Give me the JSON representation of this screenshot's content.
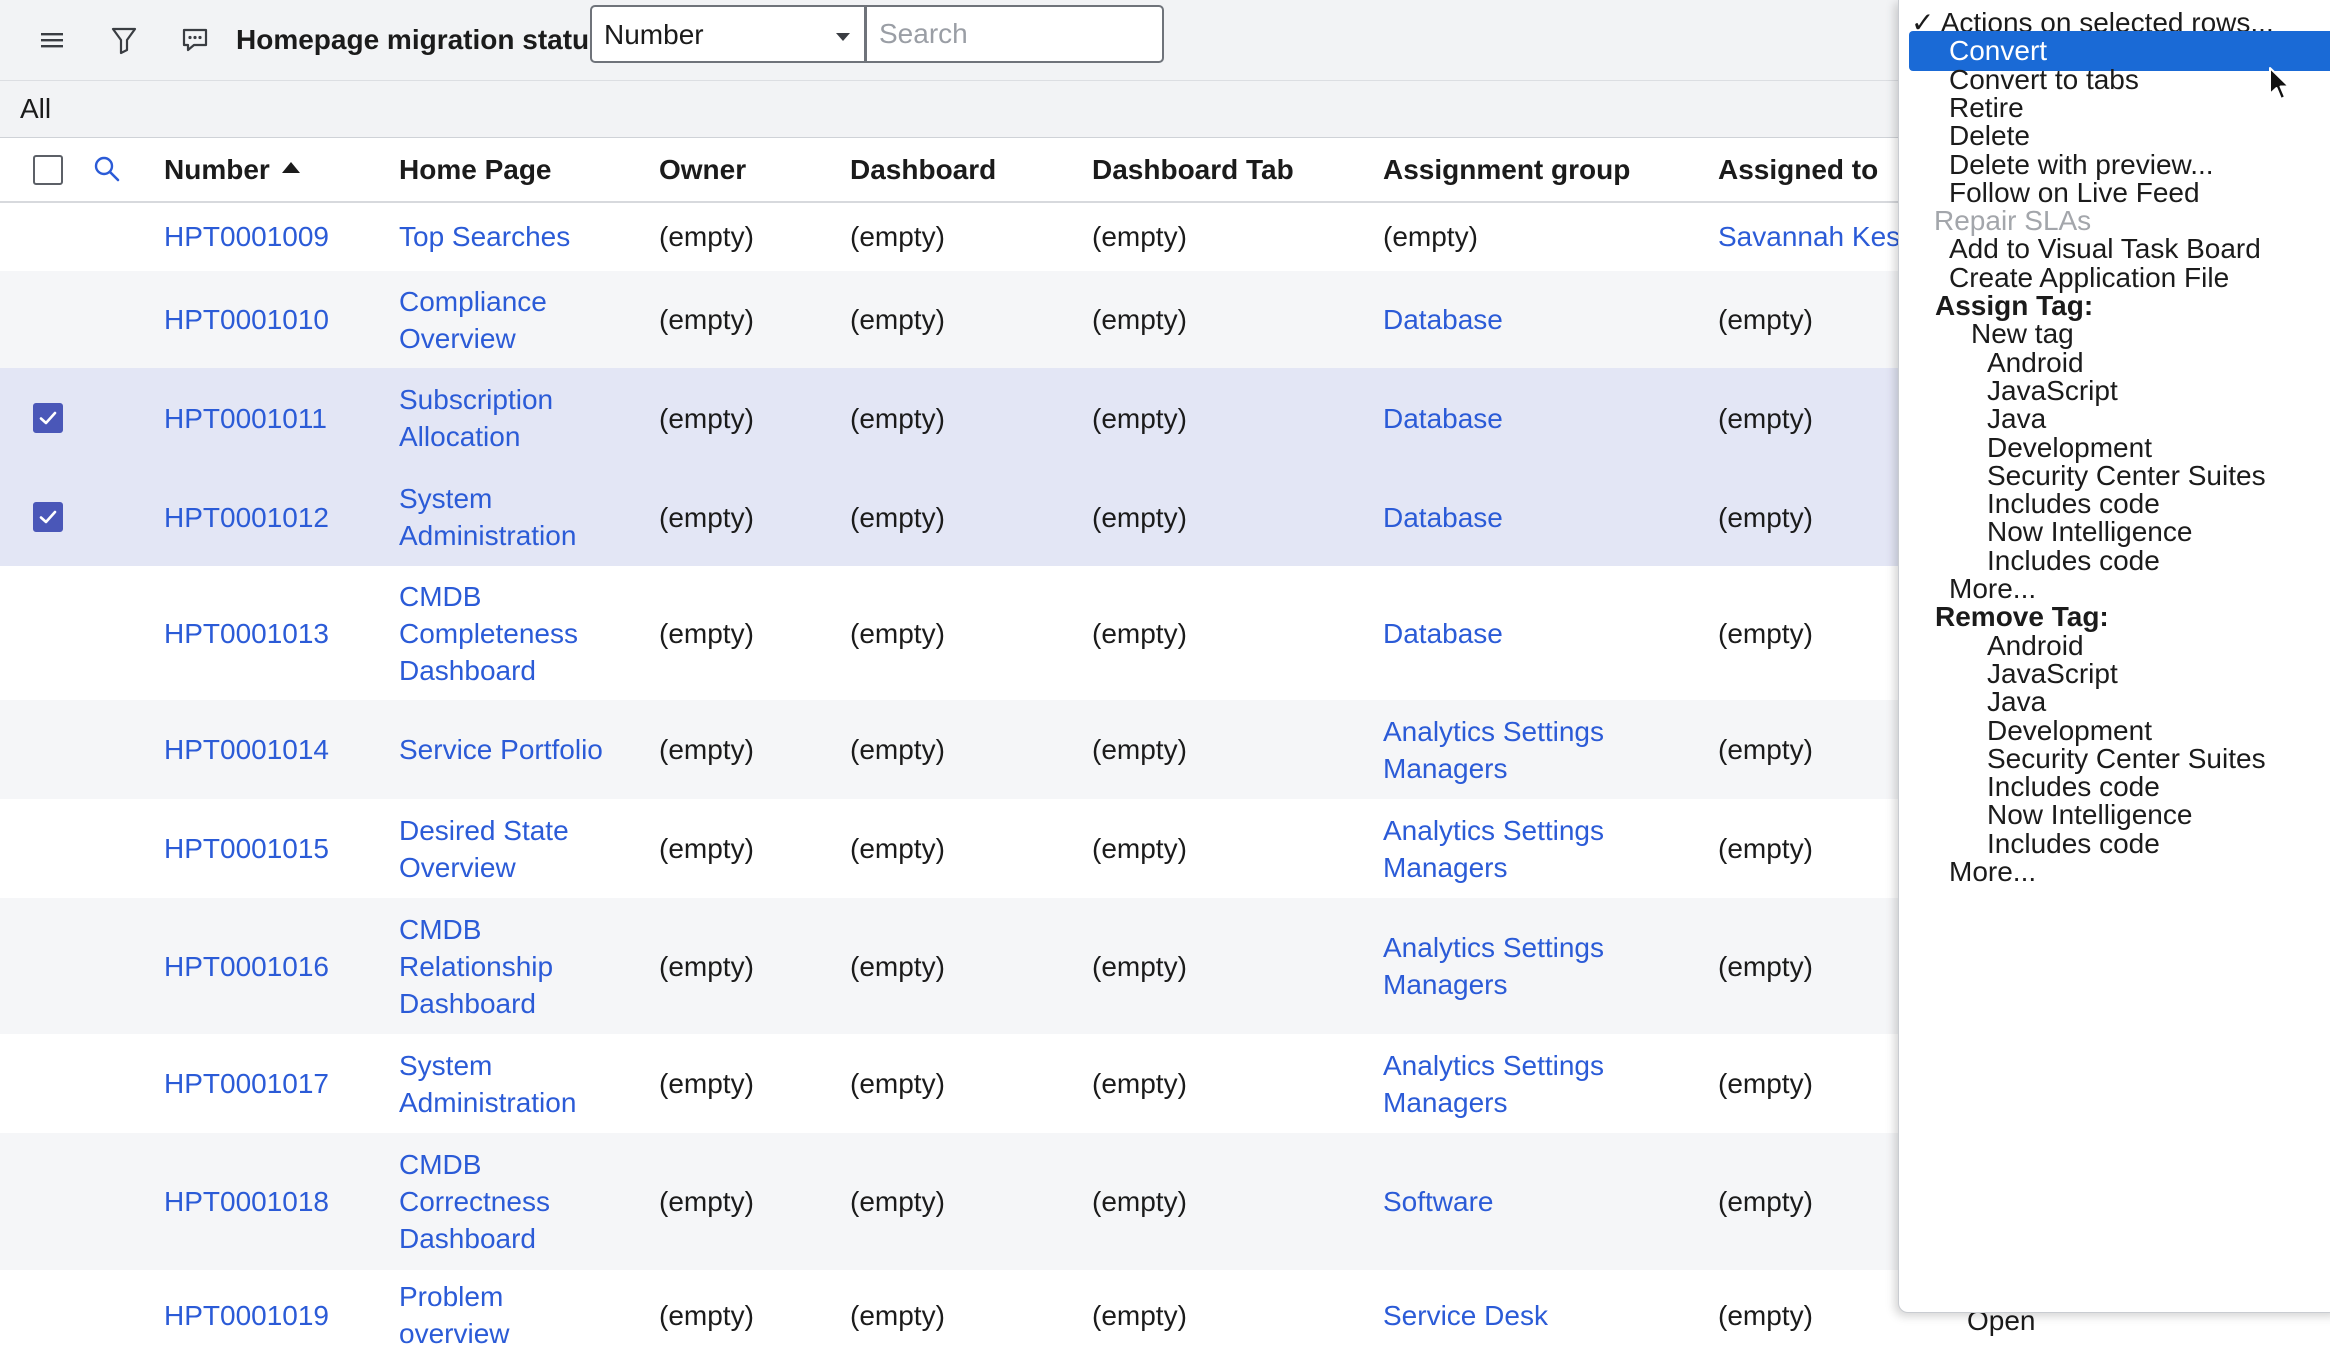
{
  "header": {
    "title": "Homepage migration status",
    "field_select": "Number",
    "search_placeholder": "Search",
    "icons": [
      "hamburger-menu-icon",
      "filter-icon",
      "comment-icon"
    ]
  },
  "breadcrumb": "All",
  "columns": {
    "number": "Number",
    "home_page": "Home Page",
    "owner": "Owner",
    "dashboard": "Dashboard",
    "dashboard_tab": "Dashboard Tab",
    "assignment_group": "Assignment group",
    "assigned_to": "Assigned to"
  },
  "rows": [
    {
      "number": "HPT0001009",
      "home": [
        "Top Searches"
      ],
      "owner": "(empty)",
      "dashboard": "(empty)",
      "tab": "(empty)",
      "group": [
        "(empty)"
      ],
      "assigned": "Savannah Kesi"
    },
    {
      "number": "HPT0001010",
      "home": [
        "Compliance",
        "Overview"
      ],
      "owner": "(empty)",
      "dashboard": "(empty)",
      "tab": "(empty)",
      "group": [
        "Database"
      ],
      "assigned": "(empty)"
    },
    {
      "number": "HPT0001011",
      "home": [
        "Subscription",
        "Allocation"
      ],
      "owner": "(empty)",
      "dashboard": "(empty)",
      "tab": "(empty)",
      "group": [
        "Database"
      ],
      "assigned": "(empty)"
    },
    {
      "number": "HPT0001012",
      "home": [
        "System",
        "Administration"
      ],
      "owner": "(empty)",
      "dashboard": "(empty)",
      "tab": "(empty)",
      "group": [
        "Database"
      ],
      "assigned": "(empty)"
    },
    {
      "number": "HPT0001013",
      "home": [
        "CMDB",
        "Completeness",
        "Dashboard"
      ],
      "owner": "(empty)",
      "dashboard": "(empty)",
      "tab": "(empty)",
      "group": [
        "Database"
      ],
      "assigned": "(empty)"
    },
    {
      "number": "HPT0001014",
      "home": [
        "Service Portfolio"
      ],
      "owner": "(empty)",
      "dashboard": "(empty)",
      "tab": "(empty)",
      "group": [
        "Analytics Settings",
        "Managers"
      ],
      "assigned": "(empty)"
    },
    {
      "number": "HPT0001015",
      "home": [
        "Desired State",
        "Overview"
      ],
      "owner": "(empty)",
      "dashboard": "(empty)",
      "tab": "(empty)",
      "group": [
        "Analytics Settings",
        "Managers"
      ],
      "assigned": "(empty)"
    },
    {
      "number": "HPT0001016",
      "home": [
        "CMDB",
        "Relationship",
        "Dashboard"
      ],
      "owner": "(empty)",
      "dashboard": "(empty)",
      "tab": "(empty)",
      "group": [
        "Analytics Settings",
        "Managers"
      ],
      "assigned": "(empty)"
    },
    {
      "number": "HPT0001017",
      "home": [
        "System",
        "Administration"
      ],
      "owner": "(empty)",
      "dashboard": "(empty)",
      "tab": "(empty)",
      "group": [
        "Analytics Settings",
        "Managers"
      ],
      "assigned": "(empty)"
    },
    {
      "number": "HPT0001018",
      "home": [
        "CMDB",
        "Correctness",
        "Dashboard"
      ],
      "owner": "(empty)",
      "dashboard": "(empty)",
      "tab": "(empty)",
      "group": [
        "Software"
      ],
      "assigned": "(empty)"
    },
    {
      "number": "HPT0001019",
      "home": [
        "Problem",
        "overview"
      ],
      "owner": "(empty)",
      "dashboard": "(empty)",
      "tab": "(empty)",
      "group": [
        "Service Desk"
      ],
      "assigned": "(empty)"
    }
  ],
  "peek_text": "Open",
  "menu": {
    "items": [
      {
        "label": "✓ Actions on selected rows...",
        "style": "header"
      },
      {
        "label": "Convert",
        "style": "highlight"
      },
      {
        "label": "Convert to tabs",
        "style": "item"
      },
      {
        "label": "Retire",
        "style": "item"
      },
      {
        "label": "Delete",
        "style": "item"
      },
      {
        "label": "Delete with preview...",
        "style": "item"
      },
      {
        "label": "Follow on Live Feed",
        "style": "item"
      },
      {
        "label": "Repair SLAs",
        "style": "disabled"
      },
      {
        "label": "Add to Visual Task Board",
        "style": "item"
      },
      {
        "label": "Create Application File",
        "style": "item"
      },
      {
        "label": "Assign Tag:",
        "style": "section"
      },
      {
        "label": "New tag",
        "style": "sub"
      },
      {
        "label": "Android",
        "style": "tag"
      },
      {
        "label": "JavaScript",
        "style": "tag"
      },
      {
        "label": "Java",
        "style": "tag"
      },
      {
        "label": "Development",
        "style": "tag"
      },
      {
        "label": "Security Center Suites",
        "style": "tag"
      },
      {
        "label": "Includes code",
        "style": "tag"
      },
      {
        "label": "Now Intelligence",
        "style": "tag"
      },
      {
        "label": "Includes code",
        "style": "tag"
      },
      {
        "label": "More...",
        "style": "item"
      },
      {
        "label": "Remove Tag:",
        "style": "section"
      },
      {
        "label": "Android",
        "style": "tag"
      },
      {
        "label": "JavaScript",
        "style": "tag"
      },
      {
        "label": "Java",
        "style": "tag"
      },
      {
        "label": "Development",
        "style": "tag"
      },
      {
        "label": "Security Center Suites",
        "style": "tag"
      },
      {
        "label": "Includes code",
        "style": "tag"
      },
      {
        "label": "Now Intelligence",
        "style": "tag"
      },
      {
        "label": "Includes code",
        "style": "tag"
      },
      {
        "label": "More...",
        "style": "item"
      }
    ]
  },
  "colors": {
    "link": "#2b5bd7",
    "menu_highlight": "#1a6ad6",
    "selected_row": "#e3e6f5",
    "checkbox_checked": "#4a57b8"
  }
}
